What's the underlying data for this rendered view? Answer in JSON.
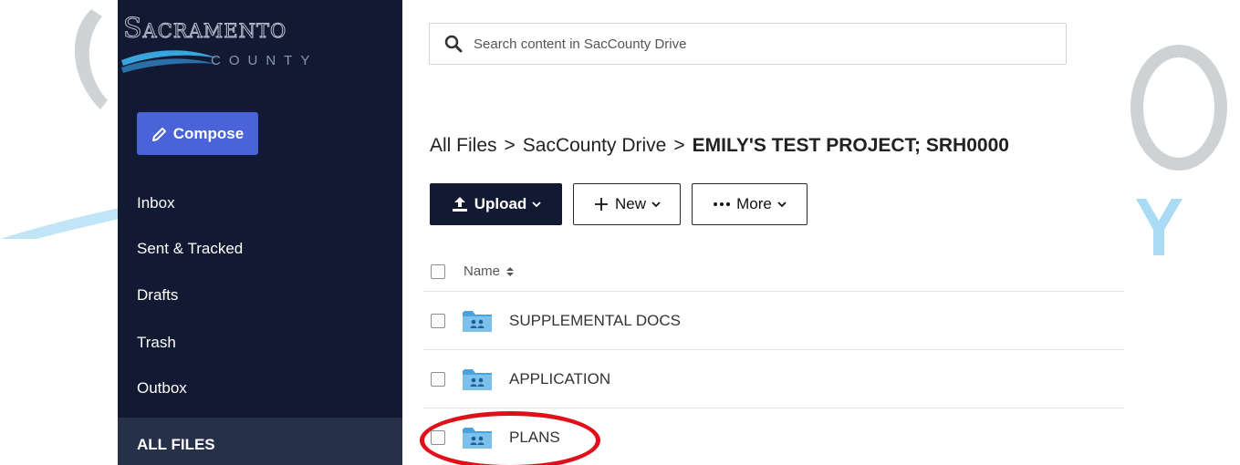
{
  "logo": {
    "word": "Sacramento",
    "sub": "COUNTY"
  },
  "sidebar": {
    "compose_label": "Compose",
    "items": [
      {
        "label": "Inbox"
      },
      {
        "label": "Sent & Tracked"
      },
      {
        "label": "Drafts"
      },
      {
        "label": "Trash"
      },
      {
        "label": "Outbox"
      },
      {
        "label": "ALL FILES"
      }
    ]
  },
  "search": {
    "placeholder": "Search content in SacCounty Drive",
    "value": ""
  },
  "breadcrumb": {
    "root": "All Files",
    "sep1": ">",
    "middle": "SacCounty Drive",
    "sep2": ">",
    "current": "EMILY'S TEST PROJECT; SRH0000"
  },
  "toolbar": {
    "upload_label": "Upload",
    "new_label": "New",
    "more_label": "More"
  },
  "list": {
    "header_name": "Name",
    "rows": [
      {
        "name": "SUPPLEMENTAL DOCS"
      },
      {
        "name": "APPLICATION"
      },
      {
        "name": "PLANS"
      }
    ]
  },
  "colors": {
    "sidebar_bg": "#121a33",
    "compose_bg": "#4a63d9",
    "highlight": "#e0101a",
    "folder": "#4aa3df"
  },
  "icons": [
    "search-icon",
    "pencil-icon",
    "upload-icon",
    "plus-icon",
    "ellipsis-icon",
    "chevron-down-icon",
    "sort-icon",
    "shared-folder-icon"
  ]
}
